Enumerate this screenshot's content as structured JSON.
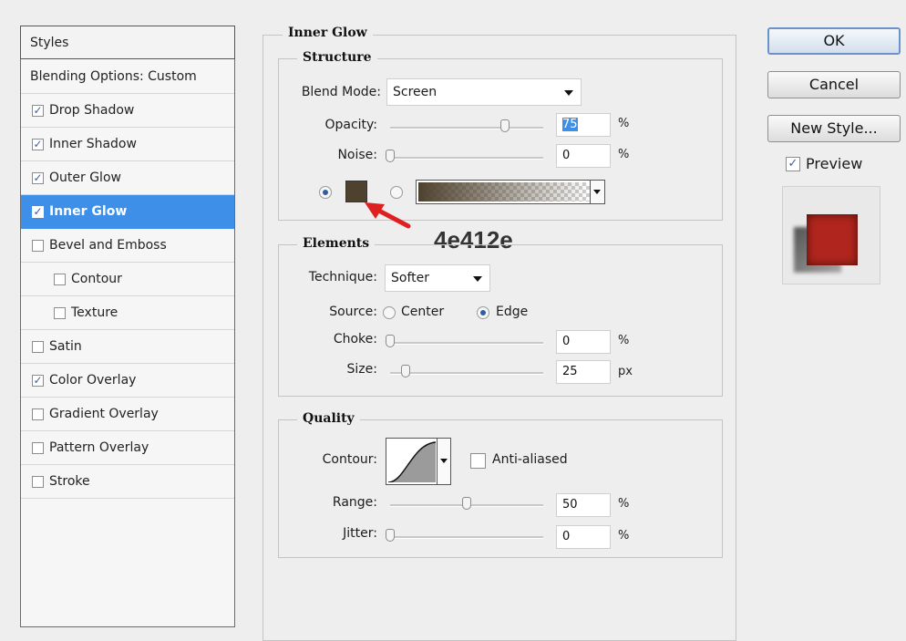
{
  "styles_panel": {
    "header": "Styles",
    "blending_options": "Blending Options: Custom",
    "items": [
      {
        "label": "Drop Shadow",
        "checked": true,
        "indent": false,
        "selected": false
      },
      {
        "label": "Inner Shadow",
        "checked": true,
        "indent": false,
        "selected": false
      },
      {
        "label": "Outer Glow",
        "checked": true,
        "indent": false,
        "selected": false
      },
      {
        "label": "Inner Glow",
        "checked": true,
        "indent": false,
        "selected": true
      },
      {
        "label": "Bevel and Emboss",
        "checked": false,
        "indent": false,
        "selected": false
      },
      {
        "label": "Contour",
        "checked": false,
        "indent": true,
        "selected": false
      },
      {
        "label": "Texture",
        "checked": false,
        "indent": true,
        "selected": false
      },
      {
        "label": "Satin",
        "checked": false,
        "indent": false,
        "selected": false
      },
      {
        "label": "Color Overlay",
        "checked": true,
        "indent": false,
        "selected": false
      },
      {
        "label": "Gradient Overlay",
        "checked": false,
        "indent": false,
        "selected": false
      },
      {
        "label": "Pattern Overlay",
        "checked": false,
        "indent": false,
        "selected": false
      },
      {
        "label": "Stroke",
        "checked": false,
        "indent": false,
        "selected": false
      }
    ]
  },
  "inner_glow": {
    "title": "Inner Glow",
    "structure": {
      "title": "Structure",
      "blend_mode_label": "Blend Mode:",
      "blend_mode_value": "Screen",
      "opacity_label": "Opacity:",
      "opacity_value": "75",
      "opacity_unit": "%",
      "opacity_fraction": 0.75,
      "noise_label": "Noise:",
      "noise_value": "0",
      "noise_unit": "%",
      "noise_fraction": 0,
      "color_swatch": "#4e412e",
      "annotation_text": "4e412e",
      "annotation_color": "#e02020"
    },
    "elements": {
      "title": "Elements",
      "technique_label": "Technique:",
      "technique_value": "Softer",
      "source_label": "Source:",
      "source_center": "Center",
      "source_edge": "Edge",
      "source_selected": "Edge",
      "choke_label": "Choke:",
      "choke_value": "0",
      "choke_unit": "%",
      "choke_fraction": 0,
      "size_label": "Size:",
      "size_value": "25",
      "size_unit": "px",
      "size_fraction": 0.1
    },
    "quality": {
      "title": "Quality",
      "contour_label": "Contour:",
      "anti_aliased_label": "Anti-aliased",
      "anti_aliased_checked": false,
      "range_label": "Range:",
      "range_value": "50",
      "range_unit": "%",
      "range_fraction": 0.5,
      "jitter_label": "Jitter:",
      "jitter_value": "0",
      "jitter_unit": "%",
      "jitter_fraction": 0
    }
  },
  "buttons": {
    "ok": "OK",
    "cancel": "Cancel",
    "new_style": "New Style...",
    "preview_label": "Preview",
    "preview_checked": true
  },
  "colors": {
    "selection_blue": "#3d8fe8",
    "preview_red": "#b0261e"
  }
}
